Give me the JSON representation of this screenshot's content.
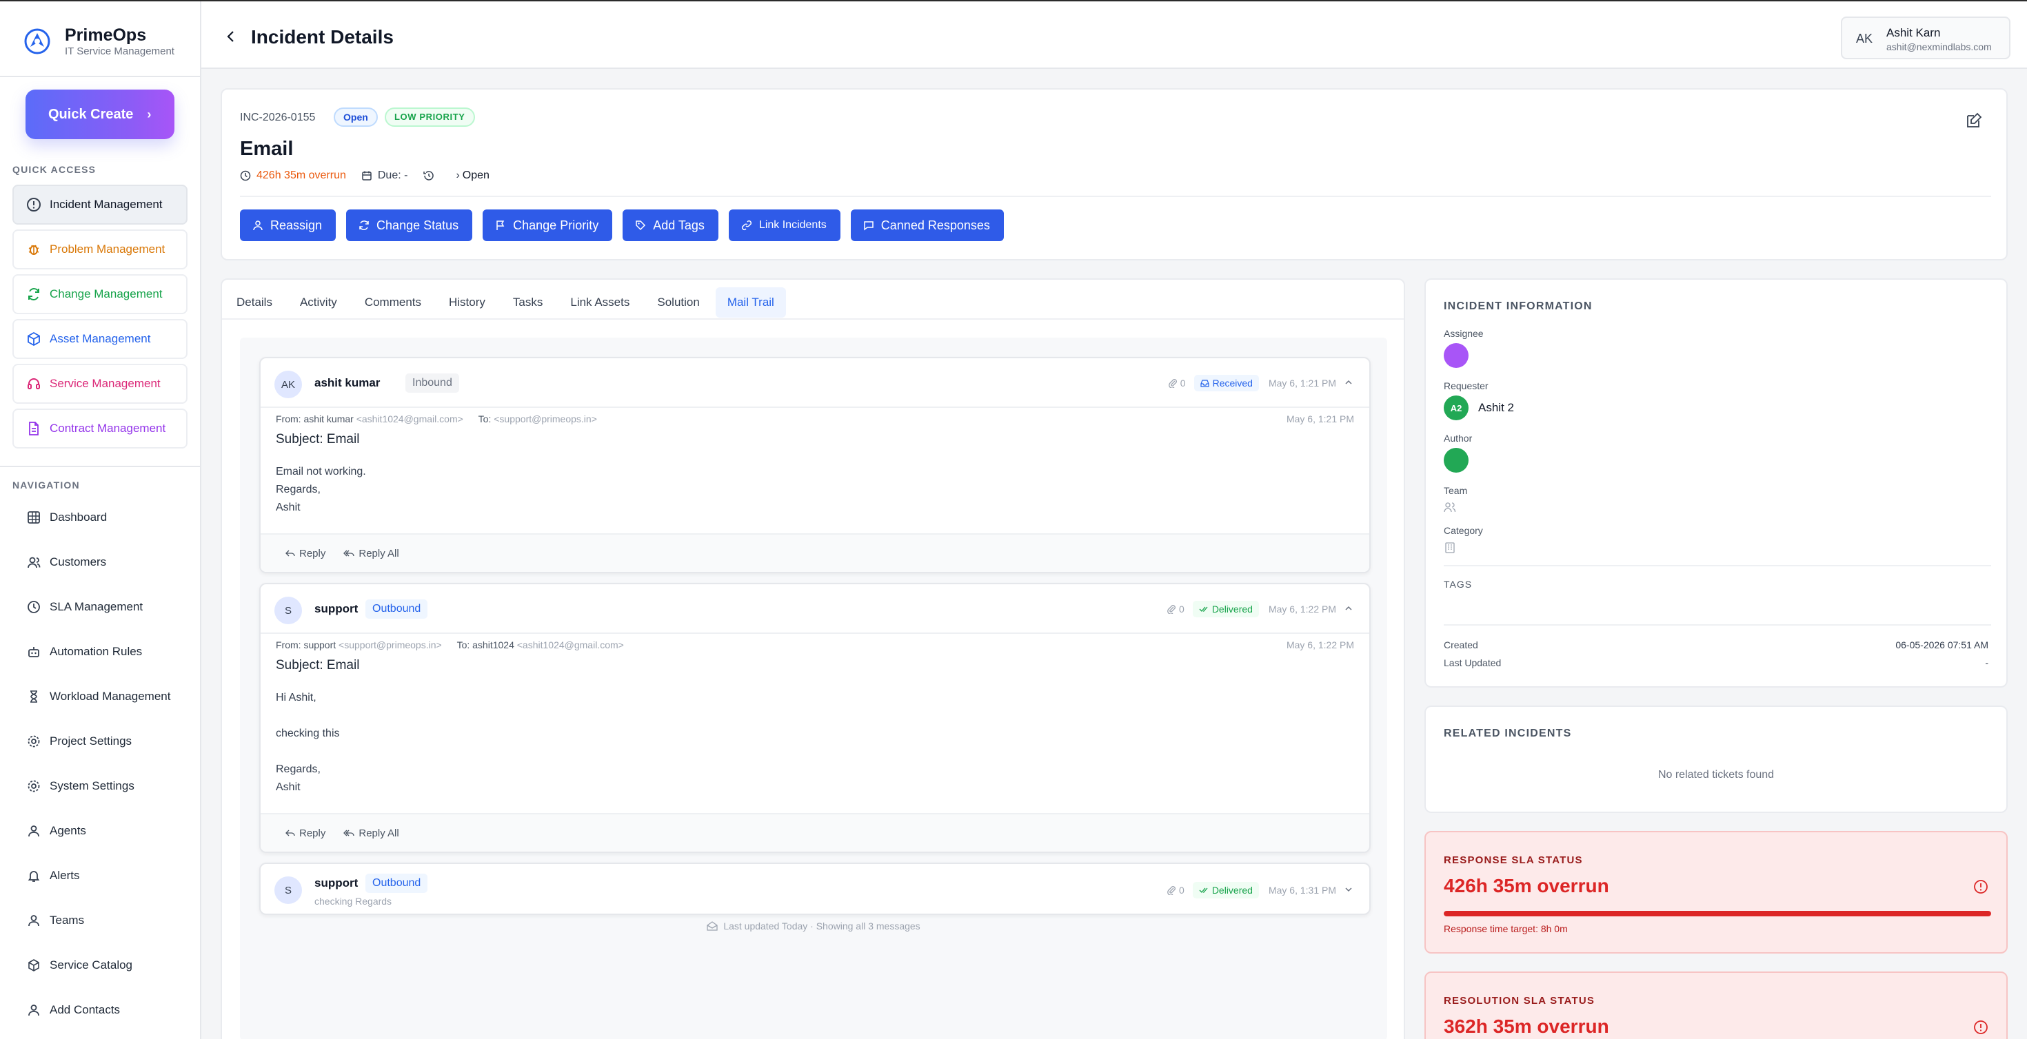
{
  "brand": {
    "name": "PrimeOps",
    "subtitle": "IT Service Management"
  },
  "quick_create": {
    "label": "Quick Create"
  },
  "sidebar": {
    "quick_access_label": "QUICK ACCESS",
    "quick_access": [
      {
        "label": "Incident Management",
        "icon": "alert-circle-icon",
        "color": "#111827"
      },
      {
        "label": "Problem Management",
        "icon": "bug-icon",
        "color": "#d97706"
      },
      {
        "label": "Change Management",
        "icon": "refresh-icon",
        "color": "#16a34a"
      },
      {
        "label": "Asset Management",
        "icon": "box-icon",
        "color": "#2563eb"
      },
      {
        "label": "Service Management",
        "icon": "headset-icon",
        "color": "#db2777"
      },
      {
        "label": "Contract Management",
        "icon": "document-icon",
        "color": "#9333ea"
      }
    ],
    "navigation_label": "NAVIGATION",
    "navigation": [
      {
        "label": "Dashboard",
        "icon": "grid-icon"
      },
      {
        "label": "Customers",
        "icon": "users-icon"
      },
      {
        "label": "SLA Management",
        "icon": "clock-icon"
      },
      {
        "label": "Automation Rules",
        "icon": "robot-icon"
      },
      {
        "label": "Workload Management",
        "icon": "hourglass-icon"
      },
      {
        "label": "Project Settings",
        "icon": "gear-icon"
      },
      {
        "label": "System Settings",
        "icon": "gear-icon"
      },
      {
        "label": "Agents",
        "icon": "user-icon"
      },
      {
        "label": "Alerts",
        "icon": "bell-icon"
      },
      {
        "label": "Teams",
        "icon": "user-icon"
      },
      {
        "label": "Service Catalog",
        "icon": "box-icon"
      },
      {
        "label": "Add Contacts",
        "icon": "user-icon"
      }
    ]
  },
  "header": {
    "title": "Incident Details",
    "user": {
      "initials": "AK",
      "name": "Ashit Karn",
      "email": "ashit@nexmindlabs.com"
    }
  },
  "incident": {
    "id": "INC-2026-0155",
    "status_badge": "Open",
    "priority_badge": "LOW PRIORITY",
    "title": "Email",
    "overrun": "426h 35m overrun",
    "due": "Due: -",
    "state": "Open",
    "actions": [
      "Reassign",
      "Change Status",
      "Change Priority",
      "Add Tags",
      "Link Incidents",
      "Canned Responses"
    ]
  },
  "tabs": [
    "Details",
    "Activity",
    "Comments",
    "History",
    "Tasks",
    "Link Assets",
    "Solution",
    "Mail Trail"
  ],
  "active_tab": "Mail Trail",
  "mail_trail": {
    "messages": [
      {
        "initials": "AK",
        "sender": "ashit kumar",
        "direction": "Inbound",
        "attachments": "0",
        "status": "Received",
        "date": "May 6, 1:21 PM",
        "from_name": "ashit kumar",
        "from_email": "<ashit1024@gmail.com>",
        "to_label": "To:",
        "to_name": "",
        "to_email": "<support@primeops.in>",
        "received": "May 6, 1:21 PM",
        "subject": "Subject: Email",
        "body": "Email not working.\nRegards,\nAshit",
        "reply": "Reply",
        "reply_all": "Reply All"
      },
      {
        "initials": "S",
        "sender": "support",
        "direction": "Outbound",
        "attachments": "0",
        "status": "Delivered",
        "date": "May 6, 1:22 PM",
        "from_name": "support",
        "from_email": "<support@primeops.in>",
        "to_label": "To:",
        "to_name": "ashit1024",
        "to_email": "<ashit1024@gmail.com>",
        "received": "May 6, 1:22 PM",
        "subject": "Subject: Email",
        "body": "Hi Ashit,\n\nchecking this\n\nRegards,\nAshit",
        "reply": "Reply",
        "reply_all": "Reply All"
      },
      {
        "initials": "S",
        "sender": "support",
        "direction": "Outbound",
        "attachments": "0",
        "status": "Delivered",
        "date": "May 6, 1:31 PM",
        "preview": "checking Regards"
      }
    ],
    "from_label": "From:",
    "footer": "Last updated Today · Showing all 3 messages"
  },
  "incident_info": {
    "title": "INCIDENT INFORMATION",
    "assignee_label": "Assignee",
    "requester_label": "Requester",
    "requester_initials": "A2",
    "requester_name": "Ashit 2",
    "author_label": "Author",
    "team_label": "Team",
    "category_label": "Category",
    "tags_label": "TAGS",
    "created_label": "Created",
    "created_value": "06-05-2026 07:51 AM",
    "updated_label": "Last Updated",
    "updated_value": "-",
    "assignee_color": "#a855f7",
    "author_color": "#22a855"
  },
  "related": {
    "title": "RELATED INCIDENTS",
    "empty": "No related tickets found"
  },
  "sla": {
    "response": {
      "title": "RESPONSE SLA STATUS",
      "value": "426h 35m overrun",
      "target": "Response time target: 8h 0m",
      "progress": 1.0
    },
    "resolution": {
      "title": "RESOLUTION SLA STATUS",
      "value": "362h 35m overrun"
    }
  },
  "colors": {
    "primary": "#2f5be8",
    "danger": "#dc2626",
    "accent_gradient_start": "#5b6cf9",
    "accent_gradient_end": "#a855f7"
  }
}
